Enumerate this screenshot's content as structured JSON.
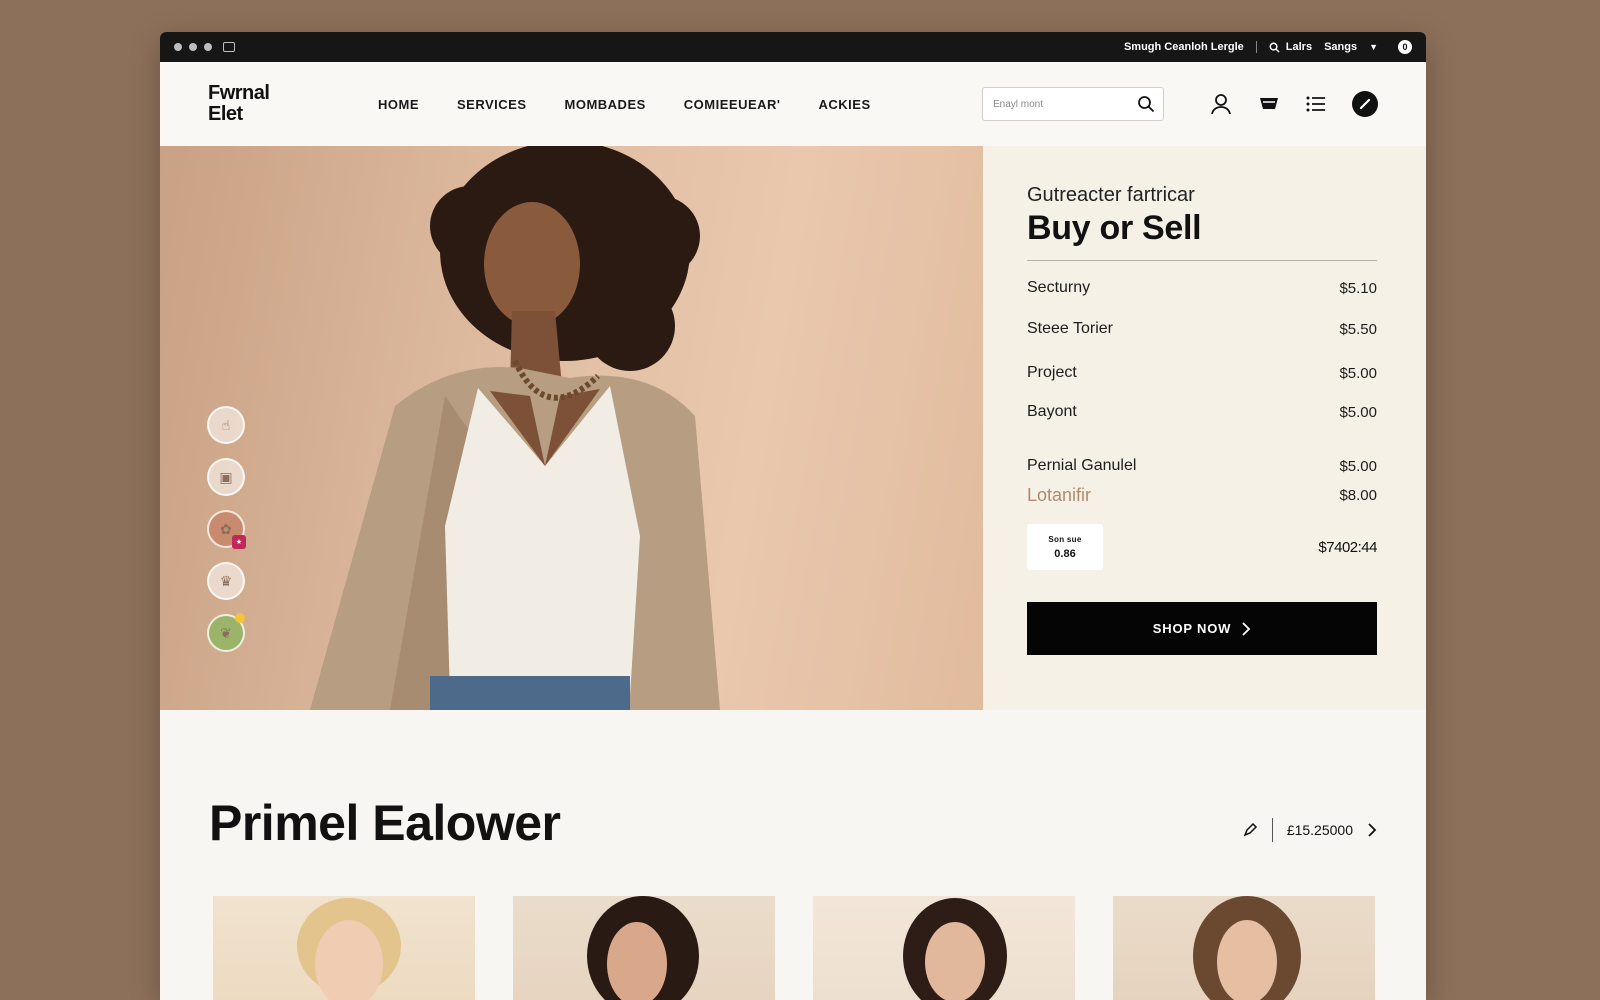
{
  "titlebar": {
    "link_text": "Smugh Ceanloh Lergle",
    "account_label": "Lalrs",
    "settings_label": "Sangs"
  },
  "header": {
    "logo_line1": "Fwrnal",
    "logo_line2": "Elet",
    "nav": [
      "HOME",
      "SERVICES",
      "MOMBADES",
      "COMIEEUEAR'",
      "ACKIES"
    ],
    "search_placeholder": "Enayl mont"
  },
  "panel": {
    "subtitle": "Gutreacter fartricar",
    "title": "Buy or Sell",
    "rows": [
      {
        "label": "Secturny",
        "price": "$5.10"
      },
      {
        "label": "Steee Torier",
        "price": "$5.50"
      },
      {
        "label": "Project",
        "price": "$5.00"
      },
      {
        "label": "Bayont",
        "price": "$5.00"
      },
      {
        "label": "Pernial Ganulel",
        "price": "$5.00"
      },
      {
        "label": "Lotanifir",
        "price": "$8.00"
      }
    ],
    "qty_label": "Son sue",
    "qty_value": "0.86",
    "total": "$7402:44",
    "cta": "SHOP NOW"
  },
  "lower": {
    "title": "Primel Ealower",
    "price_label": "£15.25000"
  },
  "colors": {
    "accent": "#050505",
    "panel_bg": "#f6f1e6",
    "page_bg": "#8d705a"
  }
}
